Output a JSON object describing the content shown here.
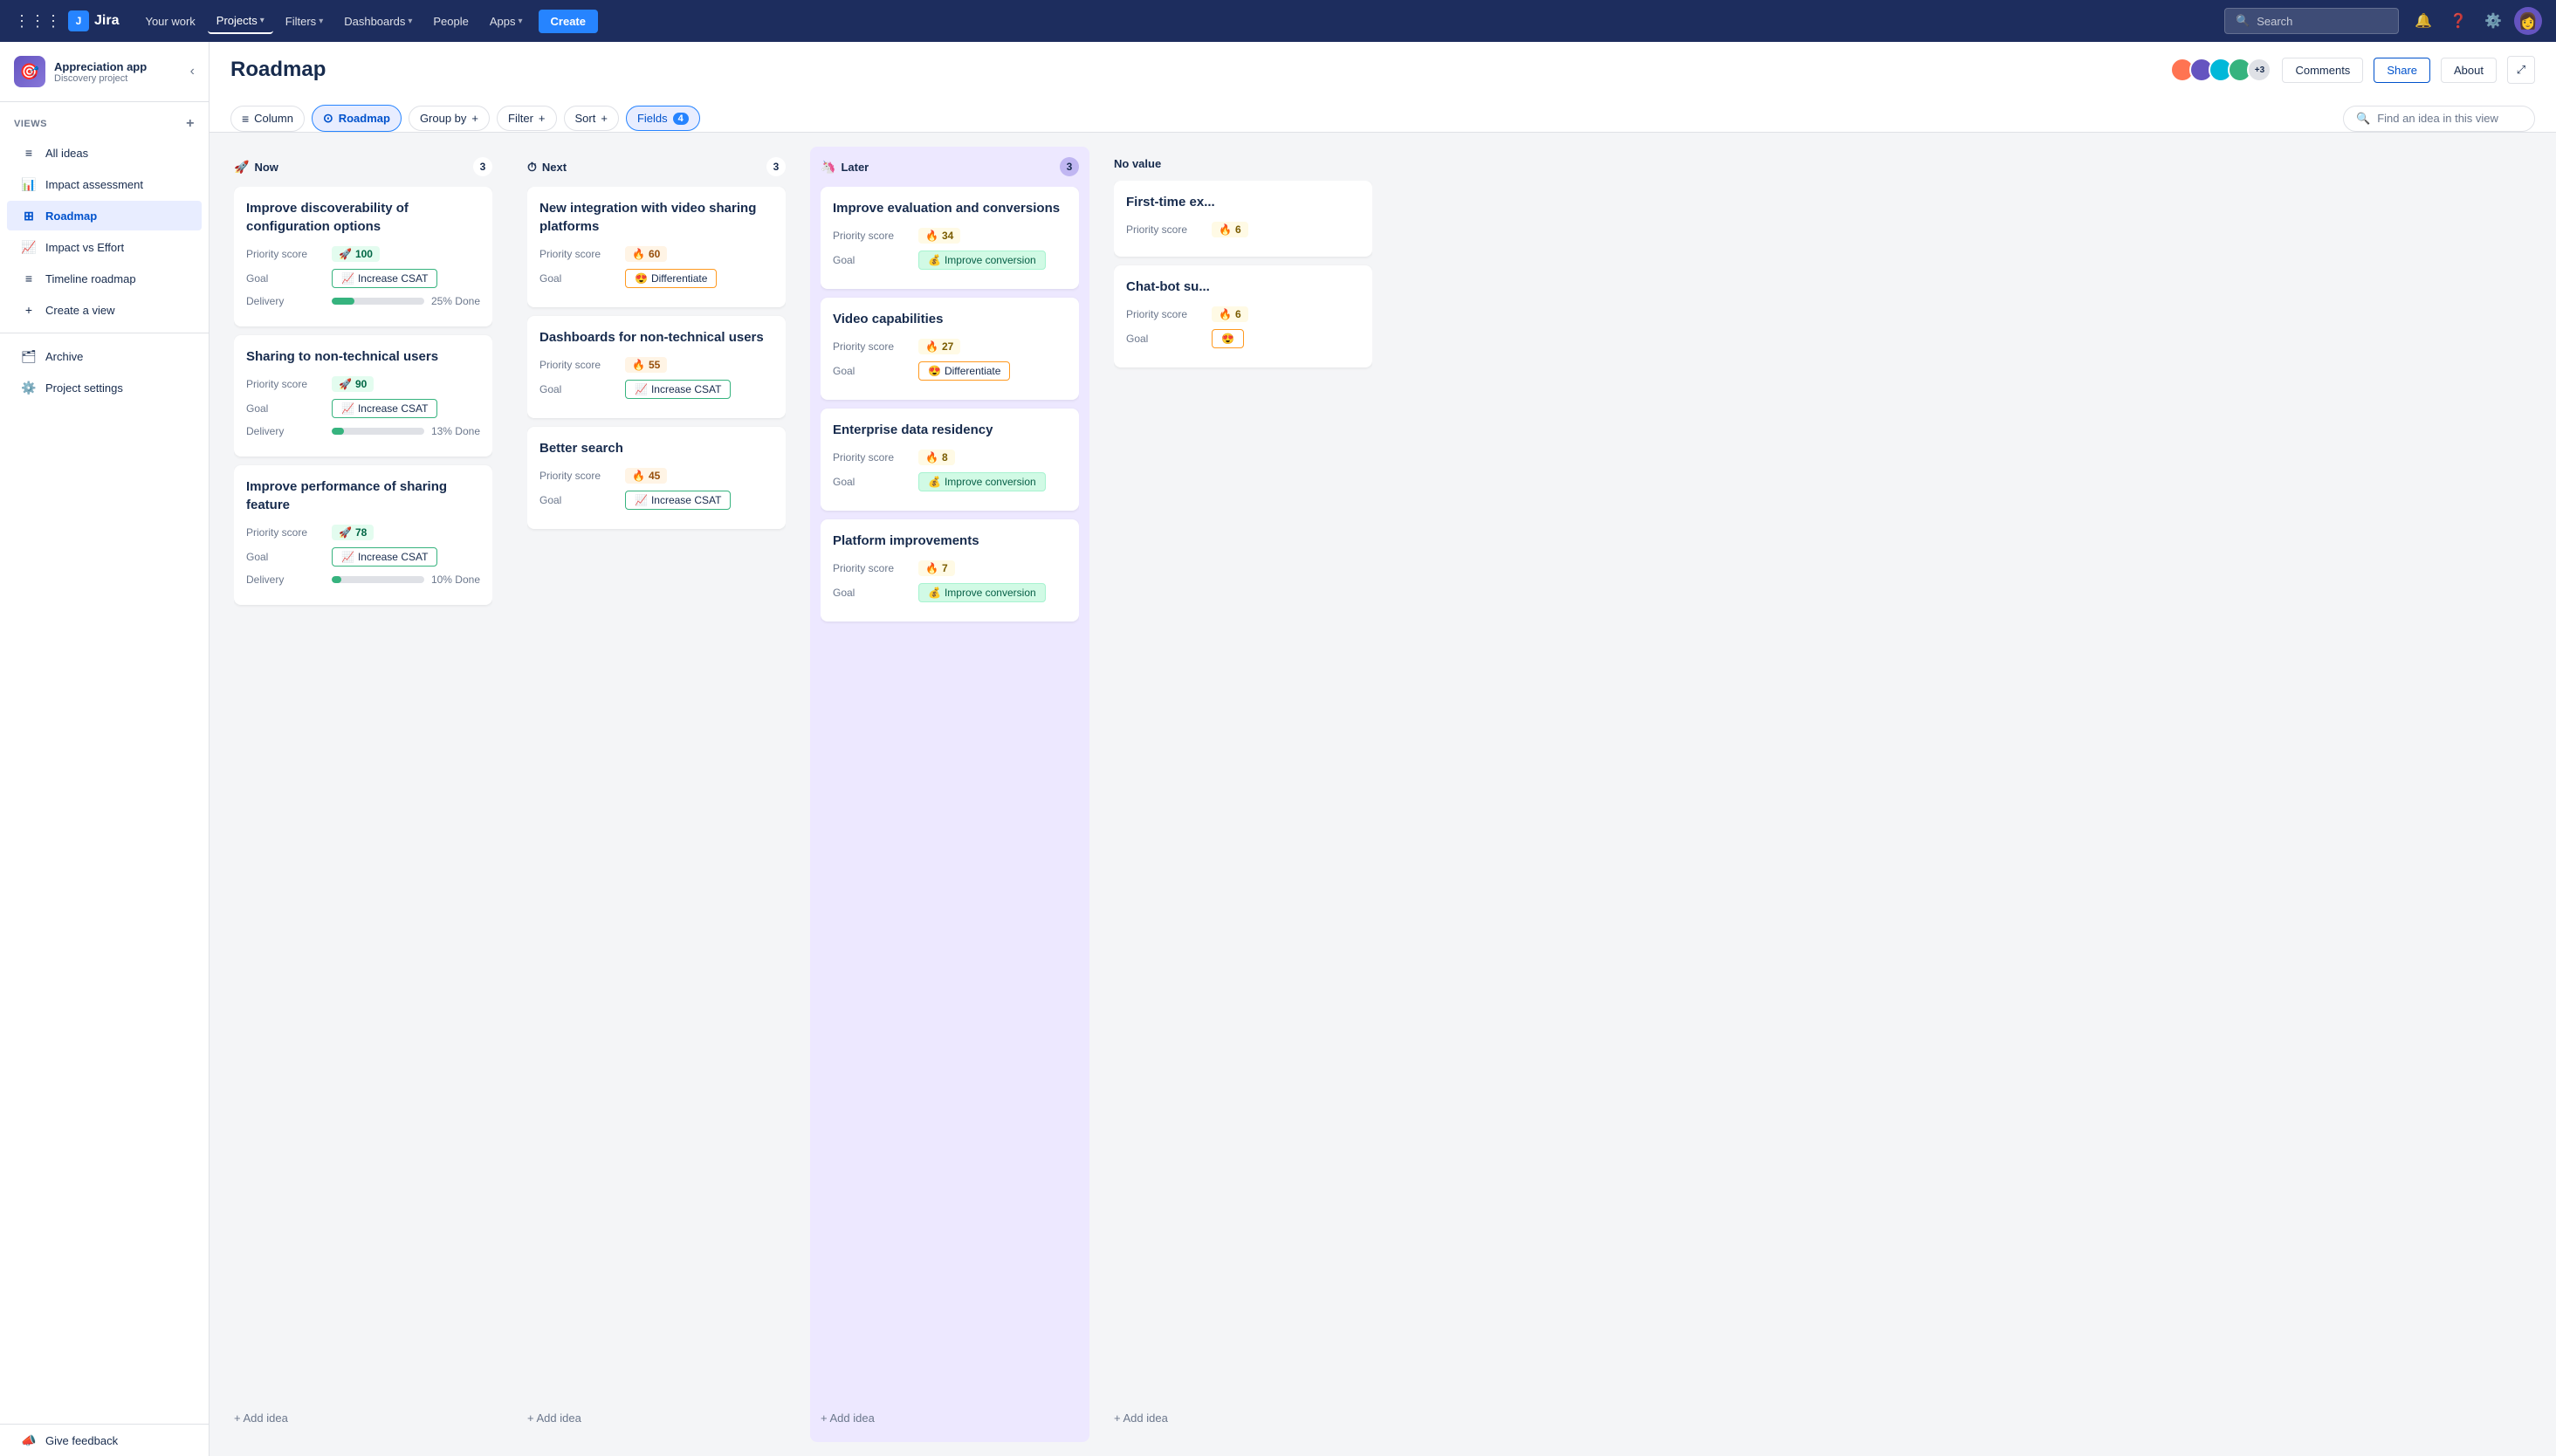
{
  "topnav": {
    "logo_text": "Jira",
    "your_work": "Your work",
    "projects": "Projects",
    "filters": "Filters",
    "dashboards": "Dashboards",
    "people": "People",
    "apps": "Apps",
    "create": "Create",
    "search_placeholder": "Search"
  },
  "sidebar": {
    "project_name": "Appreciation app",
    "project_type": "Discovery project",
    "project_icon": "🎯",
    "views_label": "VIEWS",
    "items": [
      {
        "id": "all-ideas",
        "label": "All ideas",
        "icon": "≡"
      },
      {
        "id": "impact-assessment",
        "label": "Impact assessment",
        "icon": "📊"
      },
      {
        "id": "roadmap",
        "label": "Roadmap",
        "icon": "⊞",
        "active": true
      },
      {
        "id": "impact-vs-effort",
        "label": "Impact vs Effort",
        "icon": "📈"
      },
      {
        "id": "timeline-roadmap",
        "label": "Timeline roadmap",
        "icon": "≡"
      }
    ],
    "create_view": "Create a view",
    "archive": "Archive",
    "project_settings": "Project settings",
    "give_feedback": "Give feedback"
  },
  "header": {
    "title": "Roadmap",
    "comments": "Comments",
    "share": "Share",
    "about": "About",
    "avatars": [
      "#ff7452",
      "#6554c0",
      "#00b8d9",
      "#36b37e"
    ],
    "avatar_count": "+3"
  },
  "toolbar": {
    "column_label": "Column",
    "roadmap_label": "Roadmap",
    "group_by_label": "Group by",
    "filter_label": "Filter",
    "sort_label": "Sort",
    "fields_label": "Fields",
    "fields_count": "4",
    "search_placeholder": "Find an idea in this view"
  },
  "columns": [
    {
      "id": "now",
      "title": "Now",
      "icon": "🚀",
      "count": 3,
      "color": "now",
      "cards": [
        {
          "id": "card-1",
          "title": "Improve discoverability of configuration options",
          "priority_score": "100",
          "score_color": "green",
          "goal": "Increase CSAT",
          "goal_icon": "📈",
          "goal_color": "increase-csat",
          "has_delivery": true,
          "delivery_percent": 25,
          "delivery_text": "25% Done"
        },
        {
          "id": "card-2",
          "title": "Sharing to non-technical users",
          "priority_score": "90",
          "score_color": "green",
          "goal": "Increase CSAT",
          "goal_icon": "📈",
          "goal_color": "increase-csat",
          "has_delivery": true,
          "delivery_percent": 13,
          "delivery_text": "13% Done"
        },
        {
          "id": "card-3",
          "title": "Improve performance of sharing feature",
          "priority_score": "78",
          "score_color": "green",
          "goal": "Increase CSAT",
          "goal_icon": "📈",
          "goal_color": "increase-csat",
          "has_delivery": true,
          "delivery_percent": 10,
          "delivery_text": "10% Done"
        }
      ]
    },
    {
      "id": "next",
      "title": "Next",
      "icon": "⏱",
      "count": 3,
      "color": "next",
      "cards": [
        {
          "id": "card-4",
          "title": "New integration with video sharing platforms",
          "priority_score": "60",
          "score_color": "orange",
          "goal": "Differentiate",
          "goal_icon": "😍",
          "goal_color": "differentiate",
          "has_delivery": false
        },
        {
          "id": "card-5",
          "title": "Dashboards for non-technical users",
          "priority_score": "55",
          "score_color": "orange",
          "goal": "Increase CSAT",
          "goal_icon": "📈",
          "goal_color": "increase-csat",
          "has_delivery": false
        },
        {
          "id": "card-6",
          "title": "Better search",
          "priority_score": "45",
          "score_color": "orange",
          "goal": "Increase CSAT",
          "goal_icon": "📈",
          "goal_color": "increase-csat",
          "has_delivery": false
        }
      ]
    },
    {
      "id": "later",
      "title": "Later",
      "icon": "🦄",
      "count": 3,
      "color": "later",
      "cards": [
        {
          "id": "card-7",
          "title": "Improve evaluation and conversions",
          "priority_score": "34",
          "score_color": "yellow",
          "goal": "Improve conversion",
          "goal_icon": "💰",
          "goal_color": "improve-conversion",
          "has_delivery": false
        },
        {
          "id": "card-8",
          "title": "Video capabilities",
          "priority_score": "27",
          "score_color": "yellow",
          "goal": "Differentiate",
          "goal_icon": "😍",
          "goal_color": "differentiate",
          "has_delivery": false
        },
        {
          "id": "card-9",
          "title": "Enterprise data residency",
          "priority_score": "8",
          "score_color": "yellow",
          "goal": "Improve conversion",
          "goal_icon": "💰",
          "goal_color": "improve-conversion",
          "has_delivery": false
        },
        {
          "id": "card-10",
          "title": "Platform improvements",
          "priority_score": "7",
          "score_color": "yellow",
          "goal": "Improve conversion",
          "goal_icon": "💰",
          "goal_color": "improve-conversion",
          "has_delivery": false
        }
      ]
    },
    {
      "id": "no-value",
      "title": "No value",
      "icon": "",
      "count": null,
      "color": "no-value",
      "cards": [
        {
          "id": "card-11",
          "title": "First-time ex...",
          "priority_score": "6",
          "score_color": "yellow",
          "goal": "",
          "goal_icon": "",
          "goal_color": "",
          "has_delivery": false,
          "partial": true
        },
        {
          "id": "card-12",
          "title": "Chat-bot su...",
          "priority_score": "6",
          "score_color": "yellow",
          "goal": "",
          "goal_icon": "😍",
          "goal_color": "differentiate",
          "has_delivery": false,
          "partial": true
        }
      ]
    }
  ],
  "labels": {
    "priority_score": "Priority score",
    "goal": "Goal",
    "delivery": "Delivery",
    "add_idea": "+ Add idea"
  }
}
